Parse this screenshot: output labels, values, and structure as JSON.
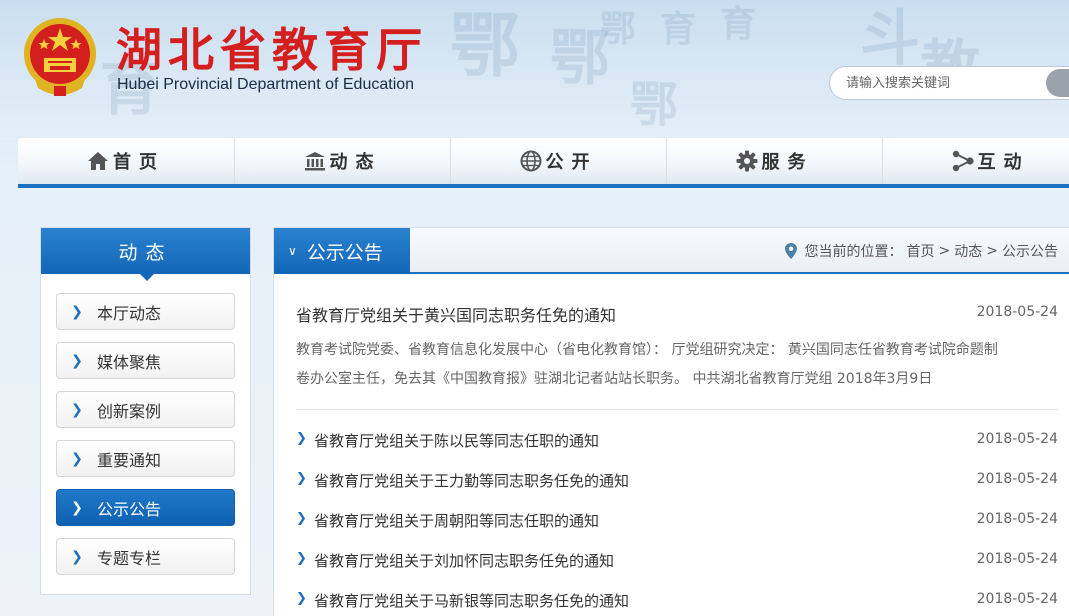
{
  "site": {
    "title": "湖北省教育厅",
    "subtitle": "Hubei Provincial Department of Education"
  },
  "search": {
    "placeholder": "请输入搜索关键词"
  },
  "nav": [
    {
      "label": "首页",
      "icon": "home-icon"
    },
    {
      "label": "动态",
      "icon": "building-icon"
    },
    {
      "label": "公开",
      "icon": "globe-icon"
    },
    {
      "label": "服务",
      "icon": "gear-icon"
    },
    {
      "label": "互动",
      "icon": "share-icon"
    }
  ],
  "sidebar": {
    "heading": "动态",
    "items": [
      {
        "label": "本厅动态"
      },
      {
        "label": "媒体聚焦"
      },
      {
        "label": "创新案例"
      },
      {
        "label": "重要通知"
      },
      {
        "label": "公示公告",
        "active": true
      },
      {
        "label": "专题专栏"
      }
    ]
  },
  "main": {
    "section_title": "公示公告",
    "breadcrumb": {
      "prefix": "您当前的位置：",
      "items": [
        "首页",
        "动态",
        "公示公告"
      ],
      "separator": ">"
    },
    "feature": {
      "title": "省教育厅党组关于黄兴国同志职务任免的通知",
      "date": "2018-05-24",
      "summary_line1": "教育考试院党委、省教育信息化发展中心（省电化教育馆）：  厅党组研究决定：  黄兴国同志任省教育考试院命题制",
      "summary_line2": "卷办公室主任，免去其《中国教育报》驻湖北记者站站长职务。      中共湖北省教育厅党组 2018年3月9日"
    },
    "news": [
      {
        "title": "省教育厅党组关于陈以民等同志任职的通知",
        "date": "2018-05-24"
      },
      {
        "title": "省教育厅党组关于王力勤等同志职务任免的通知",
        "date": "2018-05-24"
      },
      {
        "title": "省教育厅党组关于周朝阳等同志任职的通知",
        "date": "2018-05-24"
      },
      {
        "title": "省教育厅党组关于刘加怀同志职务任免的通知",
        "date": "2018-05-24"
      },
      {
        "title": "省教育厅党组关于马新银等同志职务任免的通知",
        "date": "2018-05-24"
      }
    ]
  },
  "colors": {
    "brand_red": "#d51f1f",
    "accent_blue": "#1a72c0"
  }
}
